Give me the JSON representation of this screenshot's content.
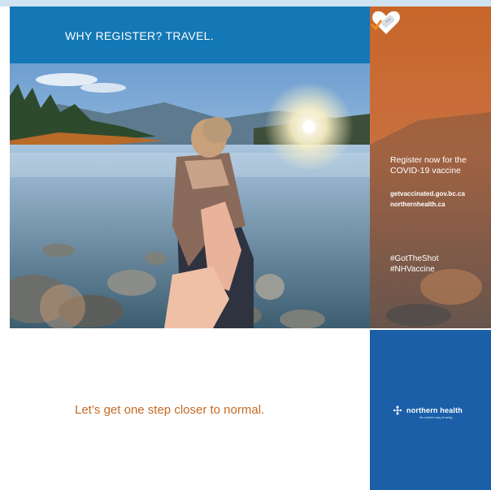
{
  "header": {
    "title": "WHY REGISTER? TRAVEL."
  },
  "side_panel": {
    "register_text": "Register now for the COVID-19 vaccine",
    "url_1": "getvaccinated.gov.bc.ca",
    "url_2": "northernhealth.ca",
    "hashtag_1": "#GotTheShot",
    "hashtag_2": "#NHVaccine",
    "icon": "heart-bandage-check-icon"
  },
  "footer": {
    "tagline": "Let’s get one step closer to normal.",
    "logo_name": "northern health",
    "logo_subtitle": "the northern way of caring"
  },
  "colors": {
    "header_blue": "#1378b5",
    "orange": "#c8662a",
    "footer_blue": "#1a5fa8",
    "tagline_orange": "#c46a25"
  }
}
